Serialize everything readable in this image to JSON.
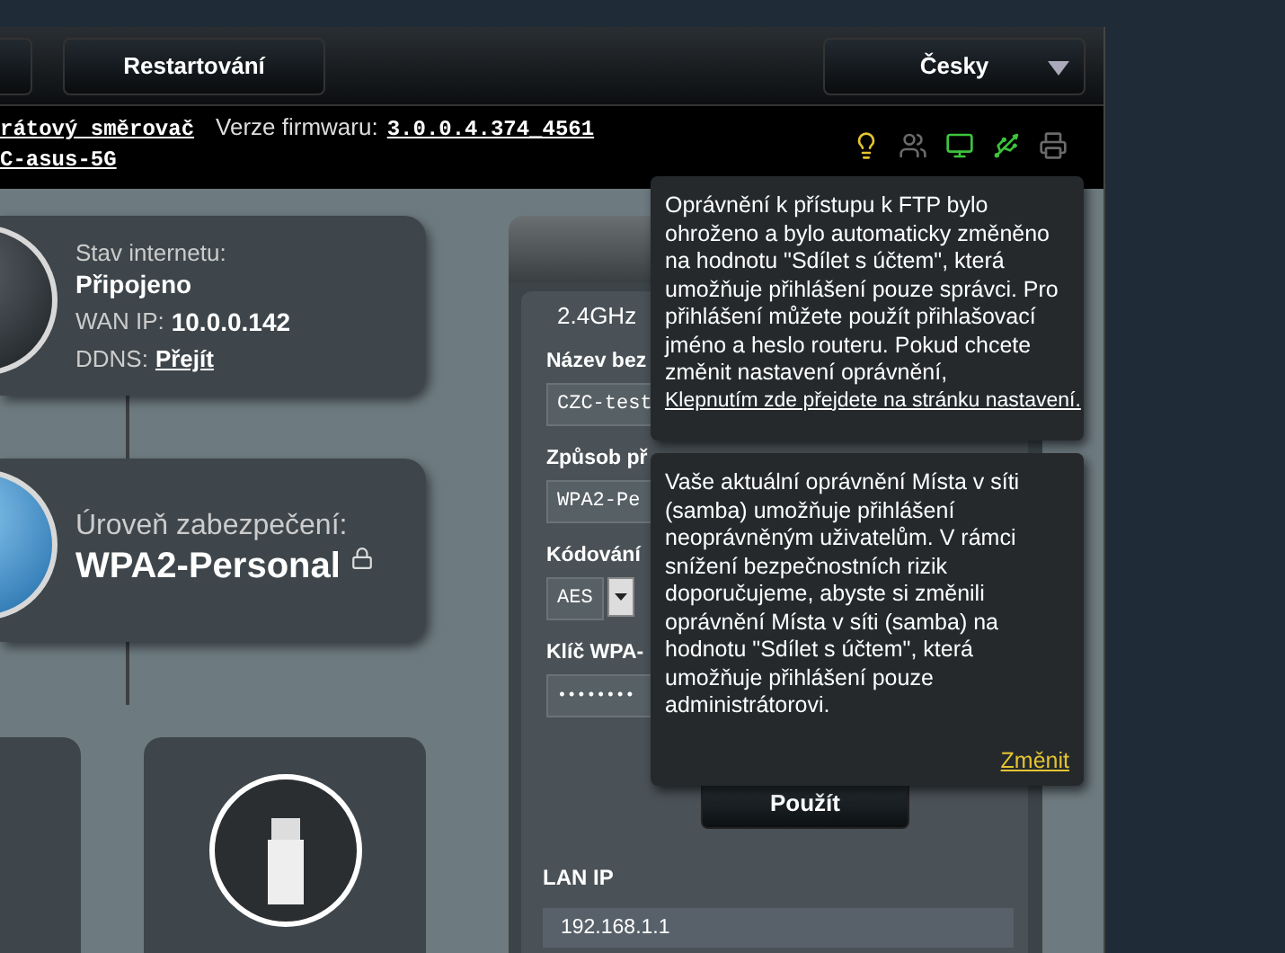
{
  "top_bar": {
    "buttons": [
      {
        "label": "Restartování"
      }
    ],
    "language": "Česky"
  },
  "info_bar": {
    "router_name": "rátový směrovač",
    "firmware_label": "Verze firmwaru:",
    "firmware_version": "3.0.0.4.374_4561",
    "ssid": "C-asus-5G",
    "status_icons": [
      {
        "kind": "bulb",
        "color": "#e6c431"
      },
      {
        "kind": "users",
        "color": "#6a6a6a"
      },
      {
        "kind": "monitor",
        "color": "#3cc43c"
      },
      {
        "kind": "usb",
        "color": "#3cc43c"
      },
      {
        "kind": "printer",
        "color": "#6a6a6a"
      }
    ]
  },
  "internet_card": {
    "label": "Stav internetu:",
    "status": "Připojeno",
    "wan_label": "WAN IP:",
    "wan_ip": "10.0.0.142",
    "ddns_label": "DDNS:",
    "ddns_link": "Přejít"
  },
  "security_card": {
    "label": "Úroveň zabezpečení:",
    "value": "WPA2-Personal"
  },
  "wireless_panel": {
    "band": "2.4GHz",
    "fields": [
      {
        "kind": "text",
        "label": "Název bez",
        "value": "CZC-test"
      },
      {
        "kind": "text",
        "label": "Způsob př",
        "value": "WPA2-Pe"
      },
      {
        "kind": "select",
        "label": "Kódování",
        "value": "AES"
      },
      {
        "kind": "password",
        "label": "Klíč WPA-",
        "value": "••••••••"
      }
    ],
    "apply_button": "Použít",
    "lan_label": "LAN IP",
    "lan_value": "192.168.1.1"
  },
  "tooltips": [
    {
      "text": "Oprávnění k přístupu k FTP bylo ohroženo a bylo automaticky změněno na hodnotu \"Sdílet s účtem\", která umožňuje přihlášení pouze správci. Pro přihlášení můžete použít přihlašovací jméno a heslo routeru. Pokud chcete změnit nastavení oprávnění,",
      "link": "Klepnutím zde přejdete na stránku nastavení.",
      "kind": "inline"
    },
    {
      "text": "Vaše aktuální oprávnění Místa v síti (samba) umožňuje přihlášení neoprávněným uživatelům. V rámci snížení bezpečnostních rizik doporučujeme, abyste si změnili oprávnění Místa v síti (samba) na hodnotu \"Sdílet s účtem\", která umožňuje přihlášení pouze administrátorovi.",
      "link": "Změnit",
      "kind": "action"
    }
  ]
}
